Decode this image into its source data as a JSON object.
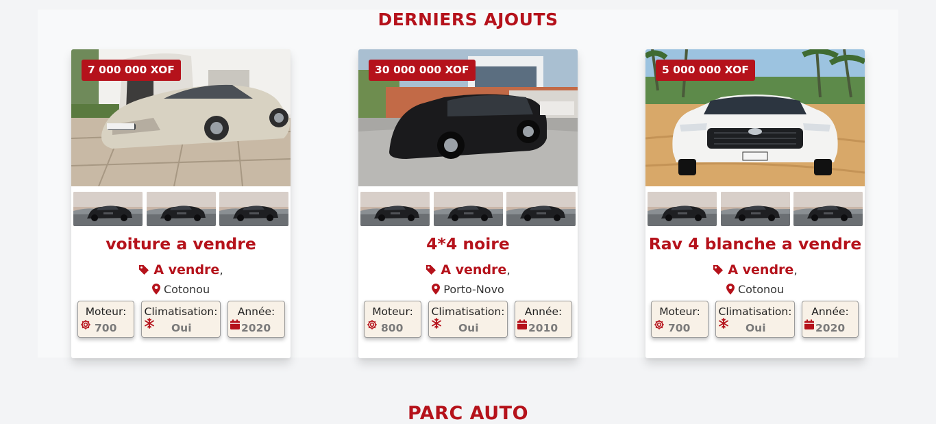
{
  "sections": {
    "latest_title": "DERNIERS AJOUTS",
    "park_title": "PARC AUTO"
  },
  "theme": {
    "accent": "#b5121b",
    "spec_bg": "#f8f1e7"
  },
  "cards": [
    {
      "price": "7 000 000 XOF",
      "title": "voiture a vendre",
      "status": "A vendre",
      "comma": ",",
      "location": "Cotonou",
      "specs": {
        "engine_label": "Moteur:",
        "engine_value": "700",
        "ac_label": "Climatisation:",
        "ac_value": "Oui",
        "year_label": "Année:",
        "year_value": "2020"
      }
    },
    {
      "price": "30 000 000 XOF",
      "title": "4*4 noire",
      "status": "A vendre",
      "comma": ",",
      "location": "Porto-Novo",
      "specs": {
        "engine_label": "Moteur:",
        "engine_value": "800",
        "ac_label": "Climatisation:",
        "ac_value": "Oui",
        "year_label": "Année:",
        "year_value": "2010"
      }
    },
    {
      "price": "5 000 000 XOF",
      "title": "Rav 4 blanche a vendre",
      "status": "A vendre",
      "comma": ",",
      "location": "Cotonou",
      "specs": {
        "engine_label": "Moteur:",
        "engine_value": "700",
        "ac_label": "Climatisation:",
        "ac_value": "Oui",
        "year_label": "Année:",
        "year_value": "2020"
      }
    }
  ],
  "icons": {
    "status": "tag-icon",
    "location": "map-marker-icon",
    "engine": "cog-icon",
    "ac": "snowflake-icon",
    "year": "calendar-icon"
  }
}
